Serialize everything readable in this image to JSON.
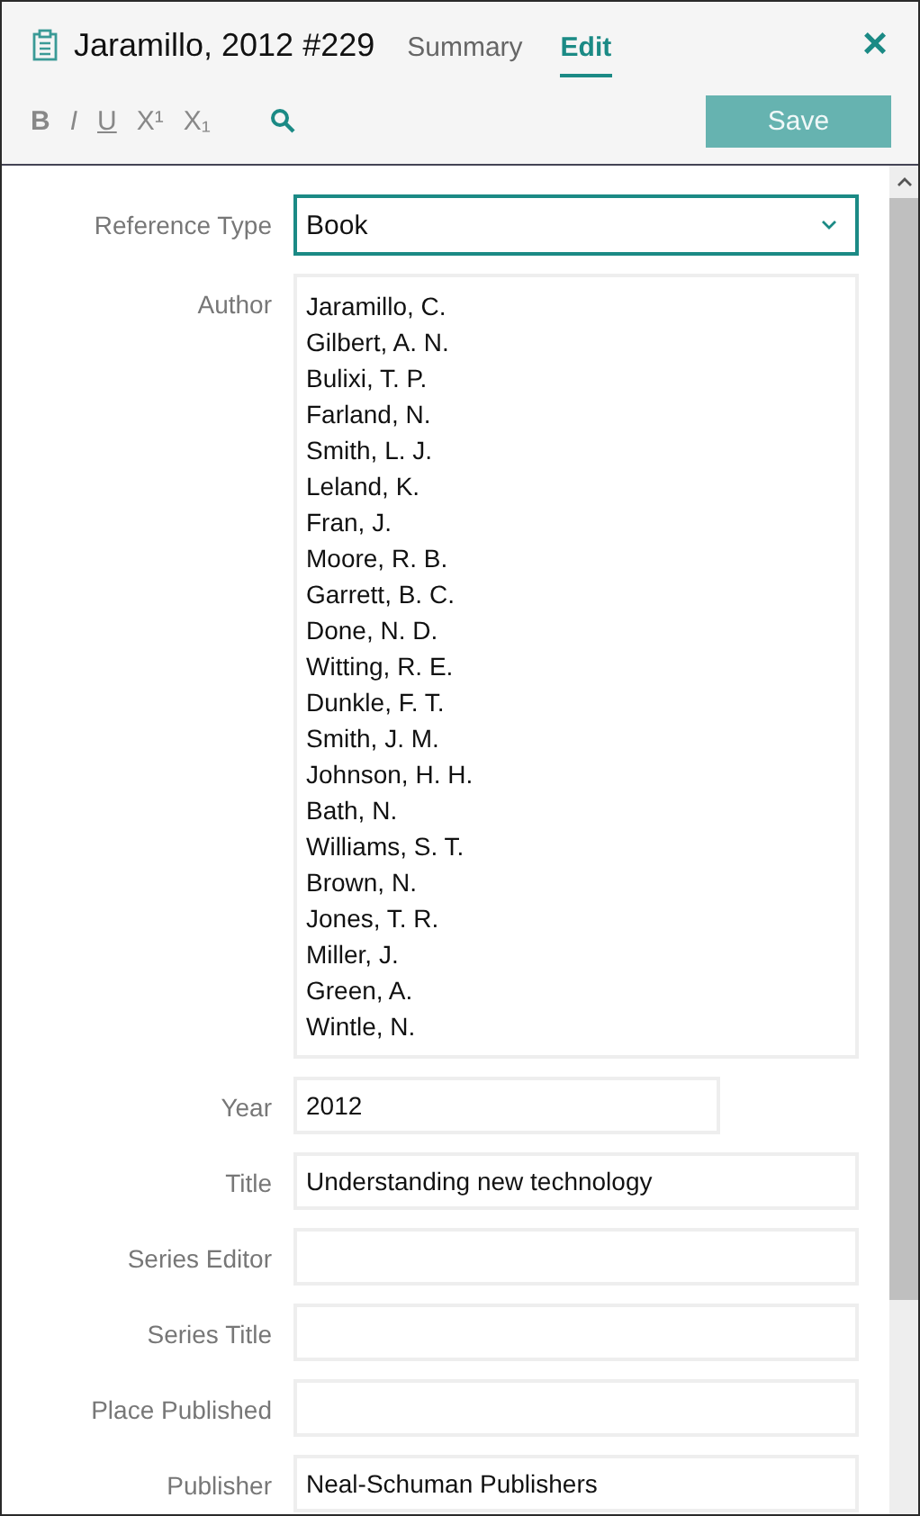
{
  "header": {
    "title": "Jaramillo, 2012 #229",
    "tabs": [
      {
        "label": "Summary",
        "selected": false
      },
      {
        "label": "Edit",
        "selected": true
      }
    ],
    "close": "×"
  },
  "toolbar": {
    "format_buttons": [
      {
        "label": "B",
        "kind": "bold"
      },
      {
        "label": "I",
        "kind": "italic"
      },
      {
        "label": "U",
        "kind": "underline"
      },
      {
        "label": "X¹",
        "kind": "plain"
      },
      {
        "label": "X₁",
        "kind": "plain"
      }
    ],
    "save": {
      "label": "Save",
      "disabled": true
    }
  },
  "fields": [
    {
      "label": "Reference Type",
      "kind": "select",
      "value": "Book",
      "focused": true
    },
    {
      "label": "Author",
      "kind": "lines",
      "lines": [
        "Jaramillo, C.",
        "Gilbert, A. N.",
        "Bulixi, T. P.",
        "Farland, N.",
        "Smith, L. J.",
        "Leland, K.",
        "Fran, J.",
        "Moore, R. B.",
        "Garrett, B. C.",
        "Done, N. D.",
        "Witting, R. E.",
        "Dunkle, F. T.",
        "Smith, J. M.",
        "Johnson, H. H.",
        "Bath, N.",
        "Williams, S. T.",
        "Brown, N.",
        "Jones, T. R.",
        "Miller, J.",
        "Green, A.",
        "Wintle, N."
      ]
    },
    {
      "label": "Year",
      "kind": "short",
      "value": "2012"
    },
    {
      "label": "Title",
      "kind": "text",
      "value": "Understanding new technology"
    },
    {
      "label": "Series Editor",
      "kind": "text"
    },
    {
      "label": "Series Title",
      "kind": "text"
    },
    {
      "label": "Place Published",
      "kind": "text"
    },
    {
      "label": "Publisher",
      "kind": "text",
      "value": "Neal-Schuman Publishers"
    }
  ]
}
